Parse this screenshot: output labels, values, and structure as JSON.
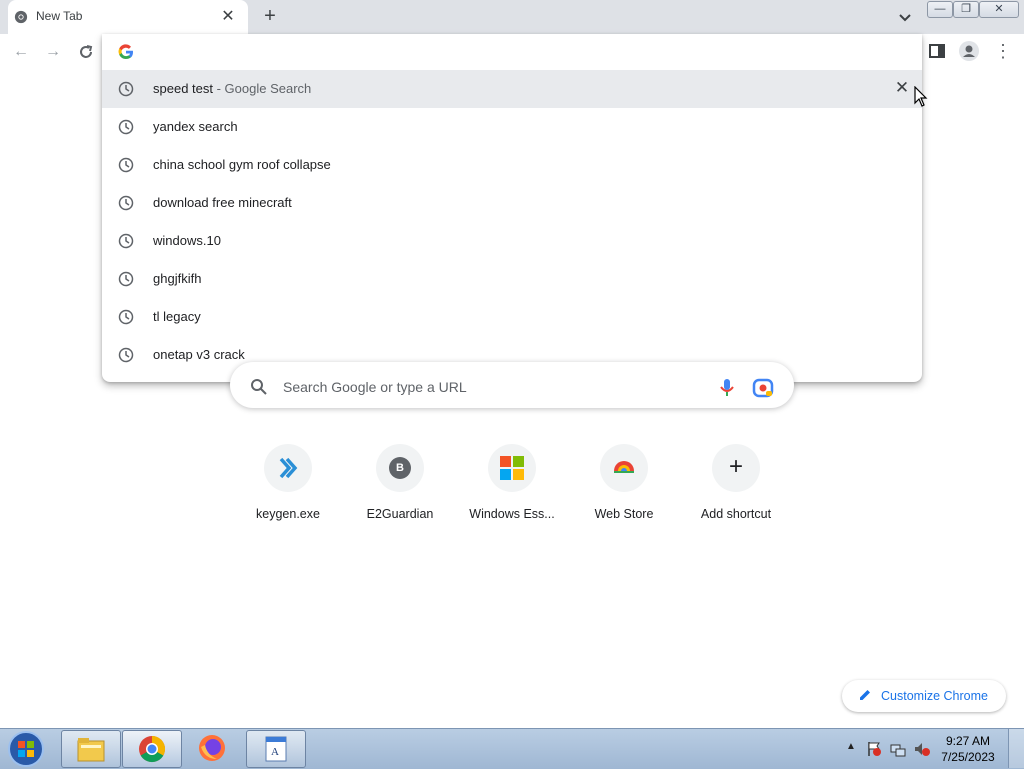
{
  "window": {
    "tab_title": "New Tab",
    "minimize": "—",
    "maximize": "❐",
    "close": "✕"
  },
  "toolbar": {
    "omnibox_value": ""
  },
  "suggestions": [
    {
      "text": "speed test",
      "sub": " - Google Search",
      "selected": true
    },
    {
      "text": "yandex search",
      "sub": ""
    },
    {
      "text": "china school gym roof collapse",
      "sub": ""
    },
    {
      "text": "download free minecraft",
      "sub": ""
    },
    {
      "text": "windows.10",
      "sub": ""
    },
    {
      "text": "ghgjfkifh",
      "sub": ""
    },
    {
      "text": "tl legacy",
      "sub": ""
    },
    {
      "text": "onetap v3 crack",
      "sub": ""
    }
  ],
  "ntp": {
    "search_placeholder": "Search Google or type a URL",
    "shortcuts": [
      {
        "label": "keygen.exe",
        "icon": "chevron-double-icon"
      },
      {
        "label": "E2Guardian",
        "icon": "letter-b-icon",
        "letter": "B"
      },
      {
        "label": "Windows Ess...",
        "icon": "windows-logo-icon"
      },
      {
        "label": "Web Store",
        "icon": "web-store-icon"
      },
      {
        "label": "Add shortcut",
        "icon": "plus-icon"
      }
    ],
    "customize_label": "Customize Chrome"
  },
  "taskbar": {
    "time": "9:27 AM",
    "date": "7/25/2023",
    "apps": [
      "file-explorer-icon",
      "chrome-icon",
      "firefox-icon",
      "wordpad-icon"
    ]
  },
  "colors": {
    "accent": "#1a73e8",
    "tabstrip": "#dee1e6",
    "selected_row": "#e8eaed"
  }
}
